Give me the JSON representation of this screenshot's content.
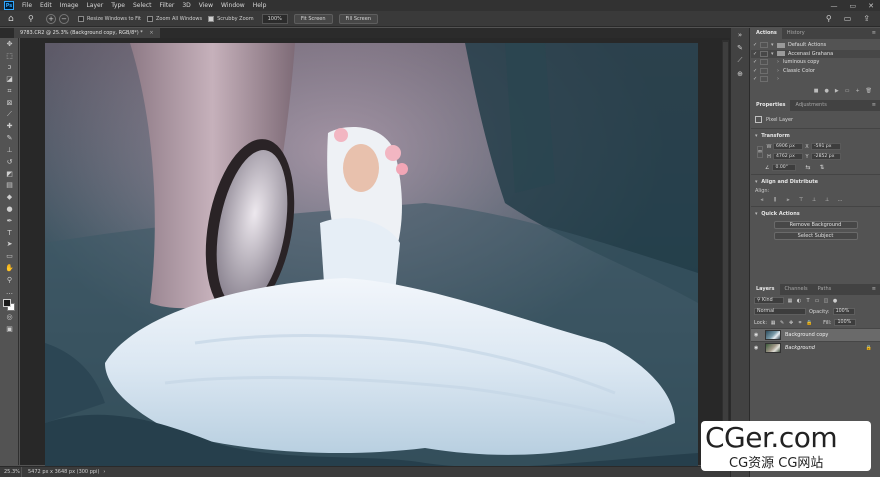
{
  "app": {
    "logo": "Ps"
  },
  "menubar": {
    "items": [
      "File",
      "Edit",
      "Image",
      "Layer",
      "Type",
      "Select",
      "Filter",
      "3D",
      "View",
      "Window",
      "Help"
    ],
    "window_controls": [
      "—",
      "▭",
      "✕"
    ]
  },
  "options_bar": {
    "resize_windows": {
      "label": "Resize Windows to Fit",
      "checked": false
    },
    "zoom_all_windows": {
      "label": "Zoom All Windows",
      "checked": false
    },
    "scrubby_zoom": {
      "label": "Scrubby Zoom",
      "checked": true
    },
    "zoom_value": "100%",
    "fit_screen": "Fit Screen",
    "fill_screen": "Fill Screen"
  },
  "document": {
    "tab_title": "9783.CR2 @ 25.3% (Background copy, RGB/8*) *",
    "close": "×"
  },
  "statusbar": {
    "zoom": "25.3%",
    "info": "5472 px x 3648 px (300 ppi)",
    "arrow": "›"
  },
  "actions_panel": {
    "tabs": [
      "Actions",
      "History"
    ],
    "rows": [
      {
        "checked": true,
        "expanded": true,
        "indent": 0,
        "type": "set",
        "label": "Default Actions"
      },
      {
        "checked": true,
        "expanded": true,
        "indent": 0,
        "type": "set",
        "label": "Accenasi Grahana",
        "selected": true
      },
      {
        "checked": true,
        "expanded": false,
        "indent": 1,
        "type": "action",
        "label": "luminous copy"
      },
      {
        "checked": true,
        "expanded": false,
        "indent": 1,
        "type": "action",
        "label": "Classic Color"
      },
      {
        "checked": true,
        "expanded": false,
        "indent": 1,
        "type": "action",
        "label": ""
      }
    ]
  },
  "properties_panel": {
    "tabs": [
      "Properties",
      "Adjustments"
    ],
    "layer_type": "Pixel Layer",
    "transform": {
      "title": "Transform",
      "w_label": "W",
      "w_value": "6906 px",
      "h_label": "H",
      "h_value": "4762 px",
      "x_label": "X",
      "x_value": "-591 px",
      "y_label": "Y",
      "y_value": "-2852 px",
      "rotation": "0.00°"
    },
    "align": {
      "title": "Align and Distribute",
      "sublabel": "Align:"
    },
    "quick_actions": {
      "title": "Quick Actions",
      "remove_bg": "Remove Background",
      "select_subject": "Select Subject"
    }
  },
  "layers_panel": {
    "tabs": [
      "Layers",
      "Channels",
      "Paths"
    ],
    "filter_kind": "Kind",
    "blend_mode": "Normal",
    "opacity_label": "Opacity:",
    "opacity_value": "100%",
    "lock_label": "Lock:",
    "fill_label": "Fill:",
    "fill_value": "100%",
    "layers": [
      {
        "name": "Background copy",
        "visible": true,
        "selected": true,
        "locked": false
      },
      {
        "name": "Background",
        "visible": true,
        "selected": false,
        "locked": true
      }
    ]
  },
  "watermark": {
    "big": "CGer.com",
    "small": "CG资源 CG网站"
  },
  "colors": {
    "menubar_bg": "#323232",
    "panel_bg": "#535353",
    "canvas_bg": "#282828",
    "ps_accent": "#31a8ff"
  }
}
